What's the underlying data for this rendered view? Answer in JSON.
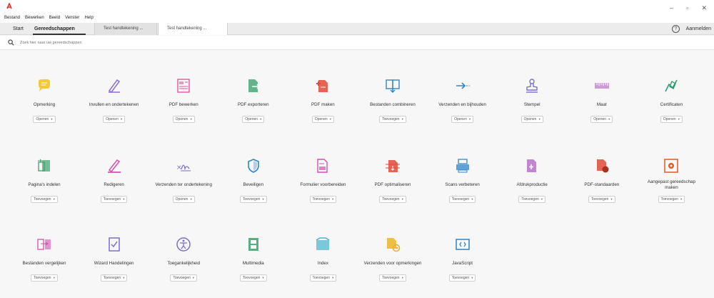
{
  "menu": [
    "Bestand",
    "Bewerken",
    "Beeld",
    "Venster",
    "Help"
  ],
  "tabs": {
    "home": "Start",
    "tools": "Gereedschappen",
    "doc1": "Test handtekening ...",
    "doc2": "Test handtekening ..."
  },
  "signin": "Aanmelden",
  "search": {
    "placeholder": "Zoek hier naar uw gereedschappen"
  },
  "window": {
    "minimize": "–",
    "maximize": "▫",
    "close": "✕"
  },
  "tools": [
    {
      "label": "Opmerking",
      "action": "Openen",
      "icon": "comment-icon",
      "color": "#f0c21a"
    },
    {
      "label": "Invullen en ondertekenen",
      "action": "Openen",
      "icon": "fill-sign-icon",
      "color": "#8a6fd6"
    },
    {
      "label": "PDF bewerken",
      "action": "Openen",
      "icon": "edit-pdf-icon",
      "color": "#e0569c"
    },
    {
      "label": "PDF exporteren",
      "action": "Openen",
      "icon": "export-pdf-icon",
      "color": "#3da26b"
    },
    {
      "label": "PDF maken",
      "action": "Openen",
      "icon": "create-pdf-icon",
      "color": "#e04a3a"
    },
    {
      "label": "Bestanden combineren",
      "action": "Toevoegen",
      "icon": "combine-files-icon",
      "color": "#2f86c9"
    },
    {
      "label": "Verzenden en bijhouden",
      "action": "Openen",
      "icon": "send-track-icon",
      "color": "#2f86c9"
    },
    {
      "label": "Stempel",
      "action": "Openen",
      "icon": "stamp-icon",
      "color": "#7a6fd0"
    },
    {
      "label": "Maat",
      "action": "Openen",
      "icon": "measure-icon",
      "color": "#b05fc2"
    },
    {
      "label": "Certificaten",
      "action": "Openen",
      "icon": "certificates-icon",
      "color": "#2c9a6a"
    },
    {
      "label": "Pagina's indelen",
      "action": "Toevoegen",
      "icon": "organize-pages-icon",
      "color": "#3da26b"
    },
    {
      "label": "Redigeren",
      "action": "Toevoegen",
      "icon": "redact-icon",
      "color": "#d44fb0"
    },
    {
      "label": "Verzenden ter ondertekening",
      "action": "Openen",
      "icon": "send-for-signature-icon",
      "color": "#7a6fd0"
    },
    {
      "label": "Beveiligen",
      "action": "Toevoegen",
      "icon": "protect-icon",
      "color": "#2f86c9"
    },
    {
      "label": "Formulier voorbereiden",
      "action": "Toevoegen",
      "icon": "prepare-form-icon",
      "color": "#d44fb0"
    },
    {
      "label": "PDF optimaliseren",
      "action": "Toevoegen",
      "icon": "optimize-pdf-icon",
      "color": "#e04a3a"
    },
    {
      "label": "Scans verbeteren",
      "action": "Toevoegen",
      "icon": "enhance-scans-icon",
      "color": "#2f86c9"
    },
    {
      "label": "Afdrukproductie",
      "action": "Toevoegen",
      "icon": "print-production-icon",
      "color": "#b05fc2"
    },
    {
      "label": "PDF-standaarden",
      "action": "Toevoegen",
      "icon": "pdf-standards-icon",
      "color": "#e04a3a"
    },
    {
      "label": "Aangepast gereedschap maken",
      "action": "Toevoegen",
      "icon": "custom-tool-icon",
      "color": "#e05a20"
    },
    {
      "label": "Bestanden vergelijken",
      "action": "Toevoegen",
      "icon": "compare-files-icon",
      "color": "#d44fb0"
    },
    {
      "label": "Wizard Handelingen",
      "action": "Toevoegen",
      "icon": "action-wizard-icon",
      "color": "#7a6fd0"
    },
    {
      "label": "Toegankelijkheid",
      "action": "Toevoegen",
      "icon": "accessibility-icon",
      "color": "#7a6fd0"
    },
    {
      "label": "Multimedia",
      "action": "Toevoegen",
      "icon": "rich-media-icon",
      "color": "#3da26b"
    },
    {
      "label": "Index",
      "action": "Toevoegen",
      "icon": "index-icon",
      "color": "#2aa6c7"
    },
    {
      "label": "Verzenden voor opmerkingen",
      "action": "Toevoegen",
      "icon": "send-for-comments-icon",
      "color": "#e8b21c"
    },
    {
      "label": "JavaScript",
      "action": "Toevoegen",
      "icon": "javascript-icon",
      "color": "#2f86c9"
    }
  ]
}
